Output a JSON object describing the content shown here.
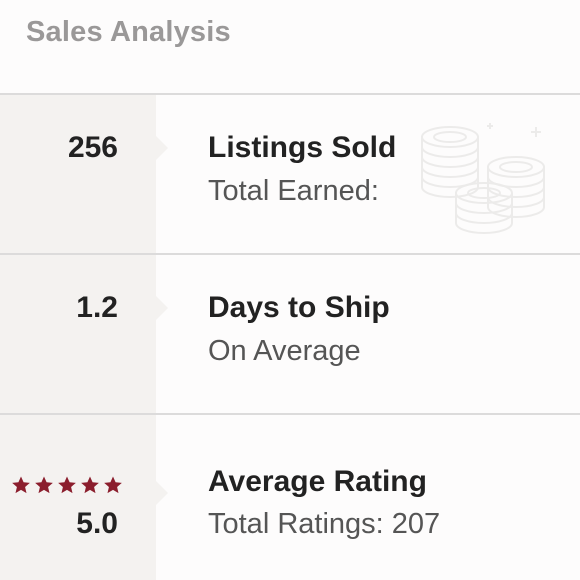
{
  "header": {
    "title": "Sales Analysis"
  },
  "rows": [
    {
      "value": "256",
      "title": "Listings Sold",
      "subtitle": "Total Earned:",
      "icon": "coins-icon"
    },
    {
      "value": "1.2",
      "title": "Days to Ship",
      "subtitle": "On Average"
    },
    {
      "value": "5.0",
      "title": "Average Rating",
      "subtitle": "Total Ratings: 207",
      "stars": 5
    }
  ],
  "colors": {
    "star": "#8b1e2d",
    "left_panel": "#f4f2f0",
    "divider": "#dcdbdb",
    "heading": "#9a9898"
  }
}
